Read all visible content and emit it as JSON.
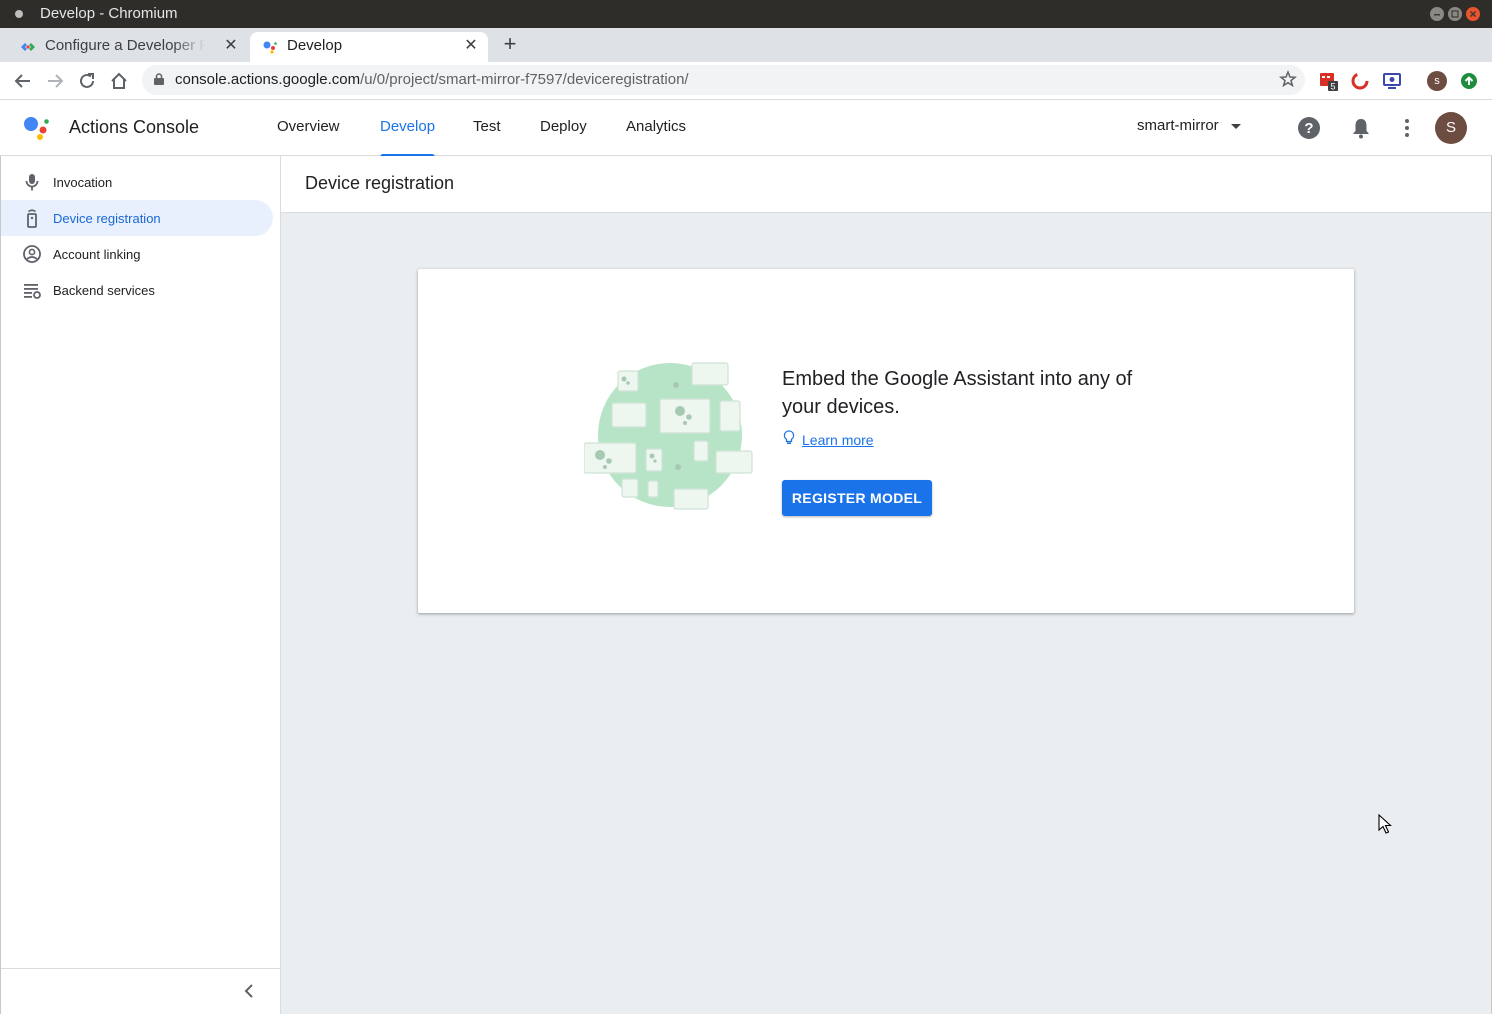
{
  "window": {
    "title": "Develop - Chromium"
  },
  "tabs": [
    {
      "label": "Configure a Developer Project"
    },
    {
      "label": "Develop"
    }
  ],
  "toolbar": {
    "url_host": "console.actions.google.com",
    "url_path": "/u/0/project/smart-mirror-f7597/deviceregistration/",
    "extension_badge": "5"
  },
  "header": {
    "brand": "Actions Console",
    "nav": [
      "Overview",
      "Develop",
      "Test",
      "Deploy",
      "Analytics"
    ],
    "active_nav": "Develop",
    "project": "smart-mirror",
    "avatar_letter": "S"
  },
  "sidebar": {
    "items": [
      {
        "label": "Invocation",
        "icon": "mic-icon"
      },
      {
        "label": "Device registration",
        "icon": "device-icon",
        "active": true
      },
      {
        "label": "Account linking",
        "icon": "account-circle-icon"
      },
      {
        "label": "Backend services",
        "icon": "settings-list-icon"
      }
    ]
  },
  "main": {
    "page_title": "Device registration",
    "card": {
      "heading": "Embed the Google Assistant into any of your devices.",
      "learn_more": "Learn more",
      "button": "REGISTER MODEL"
    }
  },
  "colors": {
    "accent": "#1a73e8",
    "active_nav_bg": "#e8f0fe",
    "main_bg": "#ebeef1",
    "illustration_green": "#b7e4c7"
  }
}
